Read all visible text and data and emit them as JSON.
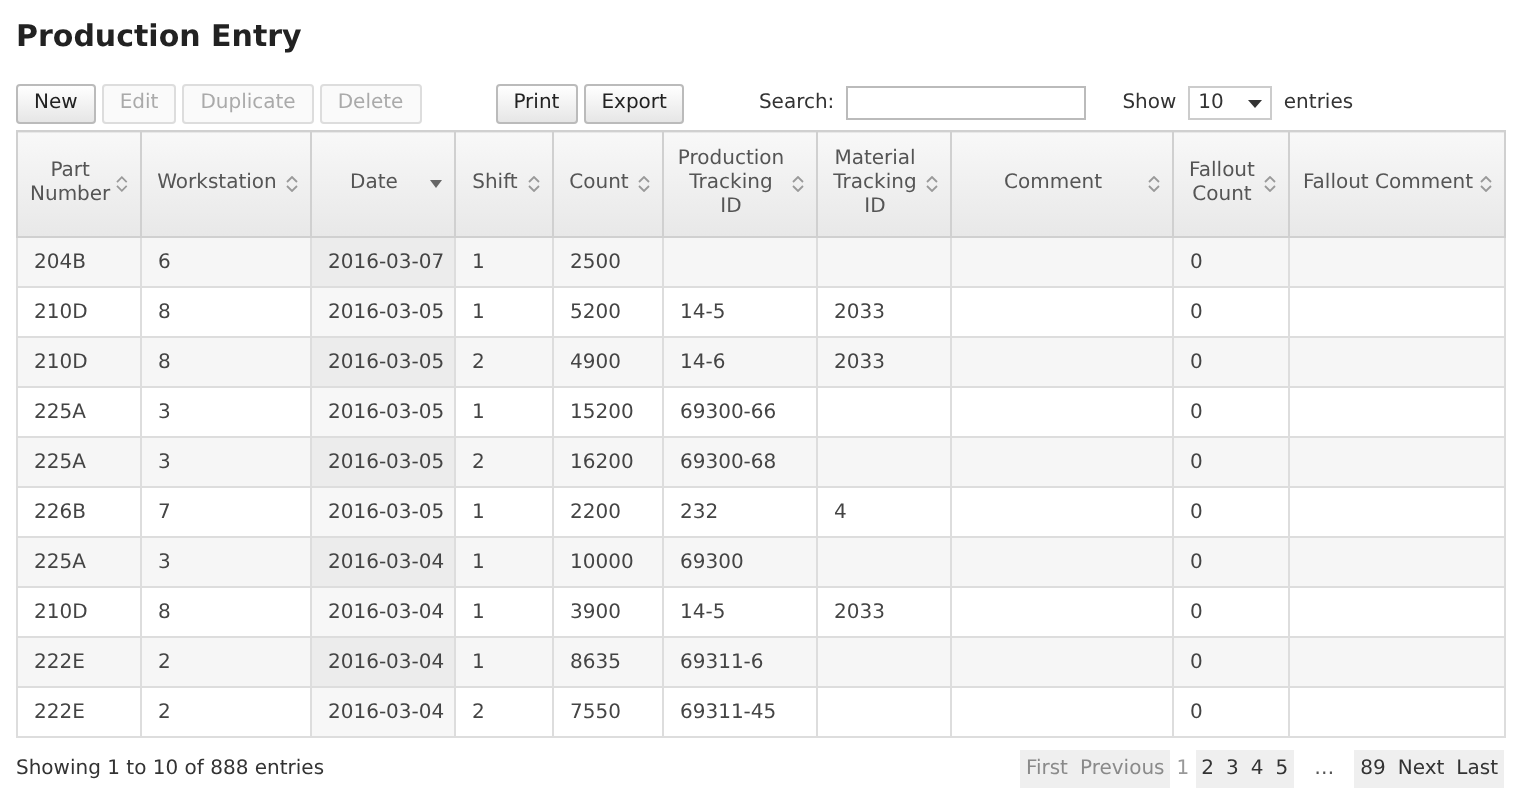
{
  "title": "Production Entry",
  "toolbar": [
    {
      "label": "New",
      "disabled": false
    },
    {
      "label": "Edit",
      "disabled": true
    },
    {
      "label": "Duplicate",
      "disabled": true
    },
    {
      "label": "Delete",
      "disabled": true
    }
  ],
  "export_buttons": [
    {
      "label": "Print"
    },
    {
      "label": "Export"
    }
  ],
  "search": {
    "label": "Search:"
  },
  "length": {
    "prefix": "Show",
    "value": "10",
    "suffix": "entries"
  },
  "table": {
    "columns": [
      {
        "label": "Part Number",
        "sorted": false
      },
      {
        "label": "Workstation",
        "sorted": false
      },
      {
        "label": "Date",
        "sorted": true
      },
      {
        "label": "Shift",
        "sorted": false
      },
      {
        "label": "Count",
        "sorted": false
      },
      {
        "label": "Production Tracking ID",
        "sorted": false
      },
      {
        "label": "Material Tracking ID",
        "sorted": false
      },
      {
        "label": "Comment",
        "sorted": false
      },
      {
        "label": "Fallout Count",
        "sorted": false
      },
      {
        "label": "Fallout Comment",
        "sorted": false
      }
    ],
    "rows": [
      [
        "204B",
        "6",
        "2016-03-07",
        "1",
        "2500",
        "",
        "",
        "",
        "0",
        ""
      ],
      [
        "210D",
        "8",
        "2016-03-05",
        "1",
        "5200",
        "14-5",
        "2033",
        "",
        "0",
        ""
      ],
      [
        "210D",
        "8",
        "2016-03-05",
        "2",
        "4900",
        "14-6",
        "2033",
        "",
        "0",
        ""
      ],
      [
        "225A",
        "3",
        "2016-03-05",
        "1",
        "15200",
        "69300-66",
        "",
        "",
        "0",
        ""
      ],
      [
        "225A",
        "3",
        "2016-03-05",
        "2",
        "16200",
        "69300-68",
        "",
        "",
        "0",
        ""
      ],
      [
        "226B",
        "7",
        "2016-03-05",
        "1",
        "2200",
        "232",
        "4",
        "",
        "0",
        ""
      ],
      [
        "225A",
        "3",
        "2016-03-04",
        "1",
        "10000",
        "69300",
        "",
        "",
        "0",
        ""
      ],
      [
        "210D",
        "8",
        "2016-03-04",
        "1",
        "3900",
        "14-5",
        "2033",
        "",
        "0",
        ""
      ],
      [
        "222E",
        "2",
        "2016-03-04",
        "1",
        "8635",
        "69311-6",
        "",
        "",
        "0",
        ""
      ],
      [
        "222E",
        "2",
        "2016-03-04",
        "2",
        "7550",
        "69311-45",
        "",
        "",
        "0",
        ""
      ]
    ]
  },
  "info": "Showing 1 to 10 of 888 entries",
  "pagination": [
    {
      "label": "First",
      "kind": "link",
      "disabled": true,
      "selected": false
    },
    {
      "label": "Previous",
      "kind": "link",
      "disabled": true,
      "selected": false
    },
    {
      "label": "1",
      "kind": "link",
      "disabled": true,
      "selected": true
    },
    {
      "label": "2",
      "kind": "link",
      "disabled": false,
      "selected": false
    },
    {
      "label": "3",
      "kind": "link",
      "disabled": false,
      "selected": false
    },
    {
      "label": "4",
      "kind": "link",
      "disabled": false,
      "selected": false
    },
    {
      "label": "5",
      "kind": "link",
      "disabled": false,
      "selected": false
    },
    {
      "label": "…",
      "kind": "ellipsis"
    },
    {
      "label": "89",
      "kind": "link",
      "disabled": false,
      "selected": false
    },
    {
      "label": "Next",
      "kind": "link",
      "disabled": false,
      "selected": false
    },
    {
      "label": "Last",
      "kind": "link",
      "disabled": false,
      "selected": false
    }
  ]
}
